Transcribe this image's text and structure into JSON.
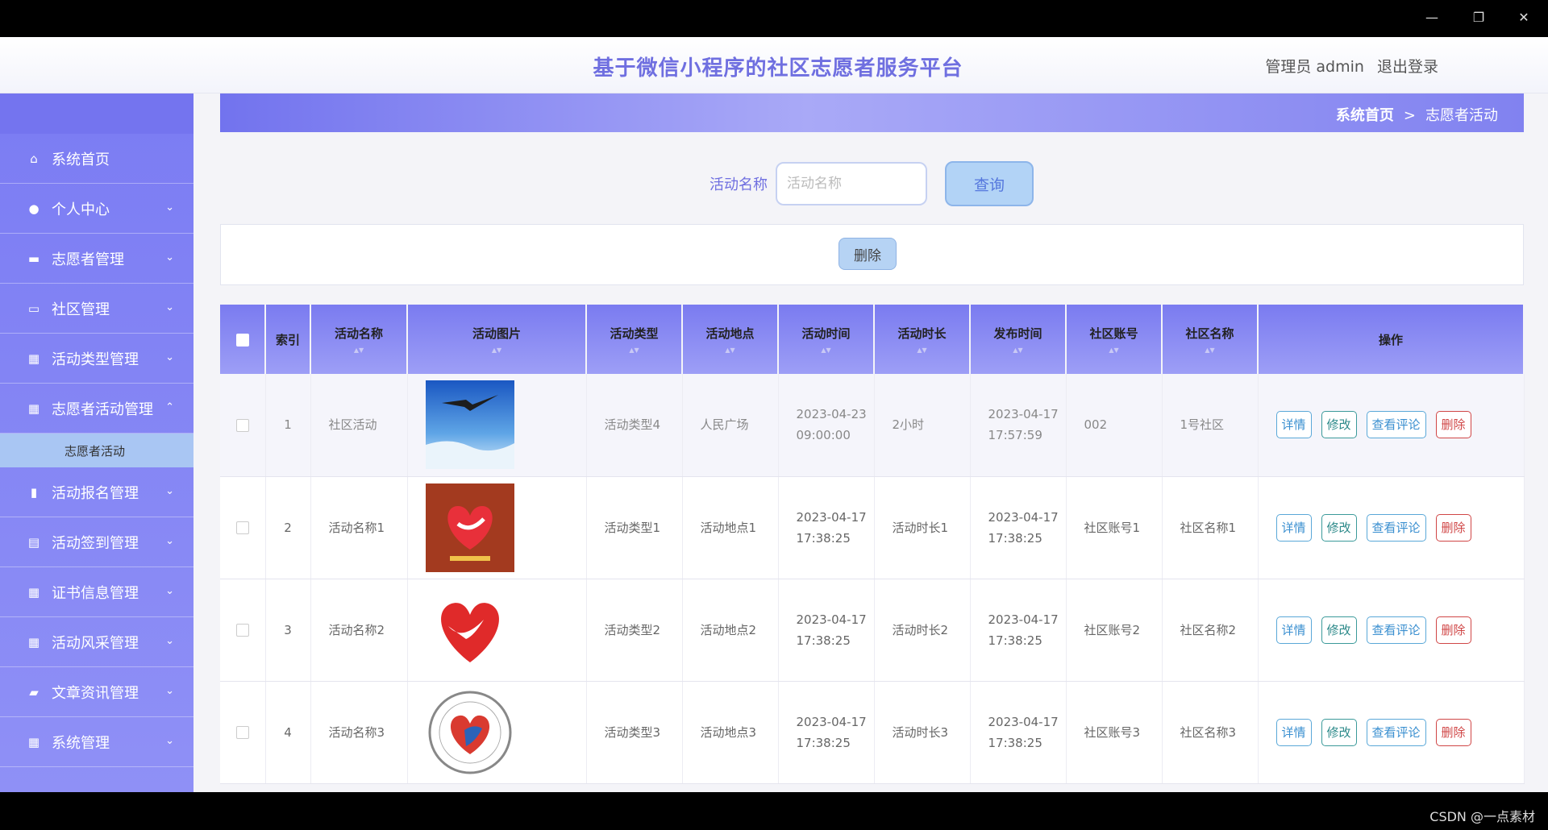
{
  "window": {
    "minimize": "—",
    "restore": "❐",
    "close": "✕"
  },
  "header": {
    "title": "基于微信小程序的社区志愿者服务平台",
    "user": "管理员 admin",
    "logout": "退出登录"
  },
  "sidebar": {
    "items": [
      {
        "label": "系统首页",
        "icon": "home-icon",
        "glyph": "⌂",
        "chev": ""
      },
      {
        "label": "个人中心",
        "icon": "user-icon",
        "glyph": "●",
        "chev": "⌄"
      },
      {
        "label": "志愿者管理",
        "icon": "briefcase-icon",
        "glyph": "▬",
        "chev": "⌄"
      },
      {
        "label": "社区管理",
        "icon": "message-icon",
        "glyph": "▭",
        "chev": "⌄"
      },
      {
        "label": "活动类型管理",
        "icon": "grid-icon",
        "glyph": "▦",
        "chev": "⌄"
      },
      {
        "label": "志愿者活动管理",
        "icon": "grid-icon",
        "glyph": "▦",
        "chev": "⌃"
      }
    ],
    "submenu": "志愿者活动",
    "items2": [
      {
        "label": "活动报名管理",
        "icon": "chart-icon",
        "glyph": "▮",
        "chev": "⌄"
      },
      {
        "label": "活动签到管理",
        "icon": "clipboard-icon",
        "glyph": "▤",
        "chev": "⌄"
      },
      {
        "label": "证书信息管理",
        "icon": "grid-icon",
        "glyph": "▦",
        "chev": "⌄"
      },
      {
        "label": "活动风采管理",
        "icon": "grid-icon",
        "glyph": "▦",
        "chev": "⌄"
      },
      {
        "label": "文章资讯管理",
        "icon": "ticket-icon",
        "glyph": "▰",
        "chev": "⌄"
      },
      {
        "label": "系统管理",
        "icon": "grid-icon",
        "glyph": "▦",
        "chev": "⌄"
      }
    ]
  },
  "breadcrumb": {
    "home": "系统首页",
    "sep": ">",
    "current": "志愿者活动"
  },
  "search": {
    "label": "活动名称",
    "placeholder": "活动名称",
    "button": "查询"
  },
  "actions": {
    "delete": "删除"
  },
  "table": {
    "headers": [
      "索引",
      "活动名称",
      "活动图片",
      "活动类型",
      "活动地点",
      "活动时间",
      "活动时长",
      "发布时间",
      "社区账号",
      "社区名称",
      "操作"
    ],
    "rows": [
      {
        "index": "1",
        "name": "社区活动",
        "type": "活动类型4",
        "place": "人民广场",
        "time": "2023-04-23 09:00:00",
        "duration": "2小时",
        "publish": "2023-04-17 17:57:59",
        "account": "002",
        "community": "1号社区"
      },
      {
        "index": "2",
        "name": "活动名称1",
        "type": "活动类型1",
        "place": "活动地点1",
        "time": "2023-04-17 17:38:25",
        "duration": "活动时长1",
        "publish": "2023-04-17 17:38:25",
        "account": "社区账号1",
        "community": "社区名称1"
      },
      {
        "index": "3",
        "name": "活动名称2",
        "type": "活动类型2",
        "place": "活动地点2",
        "time": "2023-04-17 17:38:25",
        "duration": "活动时长2",
        "publish": "2023-04-17 17:38:25",
        "account": "社区账号2",
        "community": "社区名称2"
      },
      {
        "index": "4",
        "name": "活动名称3",
        "type": "活动类型3",
        "place": "活动地点3",
        "time": "2023-04-17 17:38:25",
        "duration": "活动时长3",
        "publish": "2023-04-17 17:38:25",
        "account": "社区账号3",
        "community": "社区名称3"
      }
    ],
    "ops": {
      "detail": "详情",
      "edit": "修改",
      "comments": "查看评论",
      "delete": "删除"
    }
  },
  "colors": {
    "accent": "#7b7cf3",
    "title": "#6f6fe0",
    "danger": "#d04646"
  },
  "watermark": "CSDN @一点素材"
}
